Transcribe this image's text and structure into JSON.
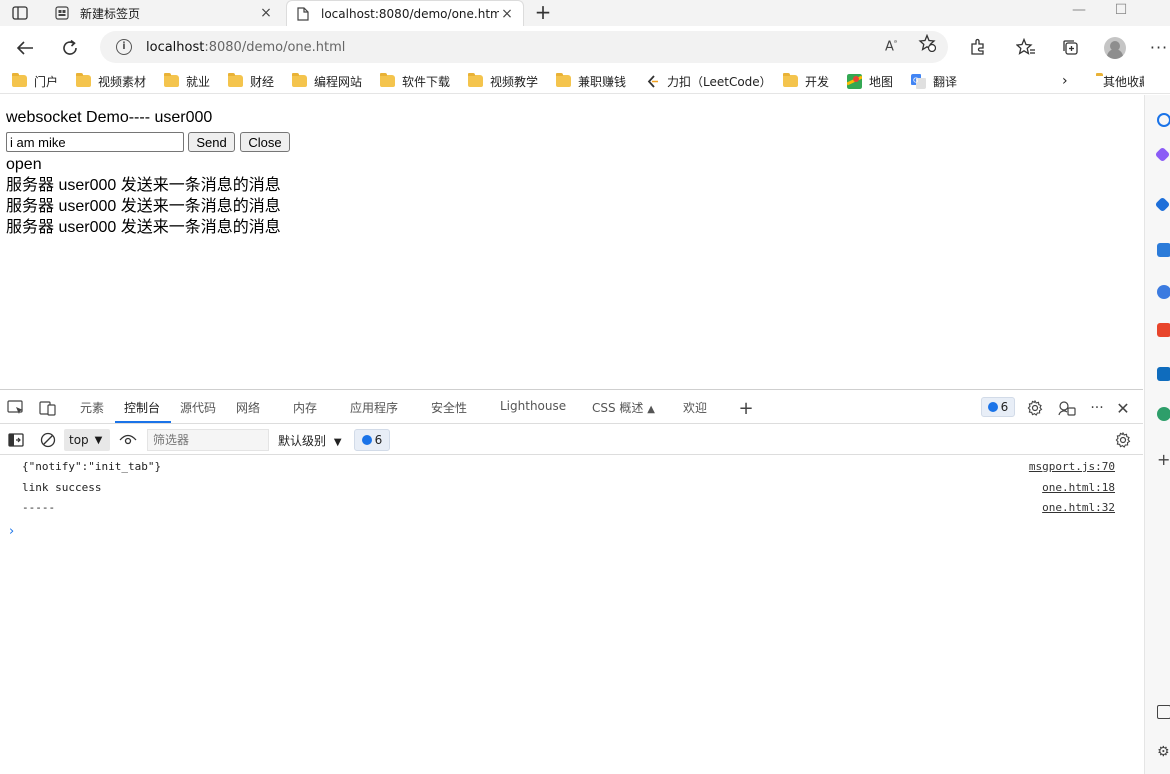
{
  "tabs": [
    {
      "label": "新建标签页",
      "active": false
    },
    {
      "label": "localhost:8080/demo/one.html",
      "active": true
    }
  ],
  "address": {
    "host": "localhost",
    "rest": ":8080/demo/one.html"
  },
  "bookmarks": [
    {
      "label": "门户",
      "icon": "folder-icon"
    },
    {
      "label": "视频素材",
      "icon": "folder-icon"
    },
    {
      "label": "就业",
      "icon": "folder-icon"
    },
    {
      "label": "财经",
      "icon": "folder-icon"
    },
    {
      "label": "编程网站",
      "icon": "folder-icon"
    },
    {
      "label": "软件下载",
      "icon": "folder-icon"
    },
    {
      "label": "视频教学",
      "icon": "folder-icon"
    },
    {
      "label": "兼职赚钱",
      "icon": "folder-icon"
    },
    {
      "label": "力扣（LeetCode）",
      "icon": "leetcode-icon"
    },
    {
      "label": "开发",
      "icon": "folder-icon"
    },
    {
      "label": "地图",
      "icon": "map-icon"
    },
    {
      "label": "翻译",
      "icon": "translate-icon"
    },
    {
      "label": "其他收藏夹",
      "icon": "folder-icon"
    }
  ],
  "page": {
    "title": "websocket Demo---- user000",
    "input_value": "i am mike",
    "send_label": "Send",
    "close_label": "Close",
    "status": "open",
    "messages": [
      "服务器 user000 发送来一条消息的消息",
      "服务器 user000 发送来一条消息的消息",
      "服务器 user000 发送来一条消息的消息"
    ]
  },
  "devtools": {
    "tabs": [
      "元素",
      "控制台",
      "源代码",
      "网络",
      "内存",
      "应用程序",
      "安全性",
      "Lighthouse",
      "CSS 概述",
      "欢迎"
    ],
    "active_tab": "控制台",
    "issues_count": "6",
    "context": "top",
    "filter_placeholder": "筛选器",
    "level": "默认级别",
    "toolbar_issues": "6",
    "console": [
      {
        "message": "{\"notify\":\"init_tab\"}",
        "source": "msgport.js:70"
      },
      {
        "message": "link success",
        "source": "one.html:18"
      },
      {
        "message": "-----",
        "source": "one.html:32"
      }
    ]
  },
  "colors": {
    "accent": "#1a73e8",
    "folder": "#f4c44d"
  }
}
